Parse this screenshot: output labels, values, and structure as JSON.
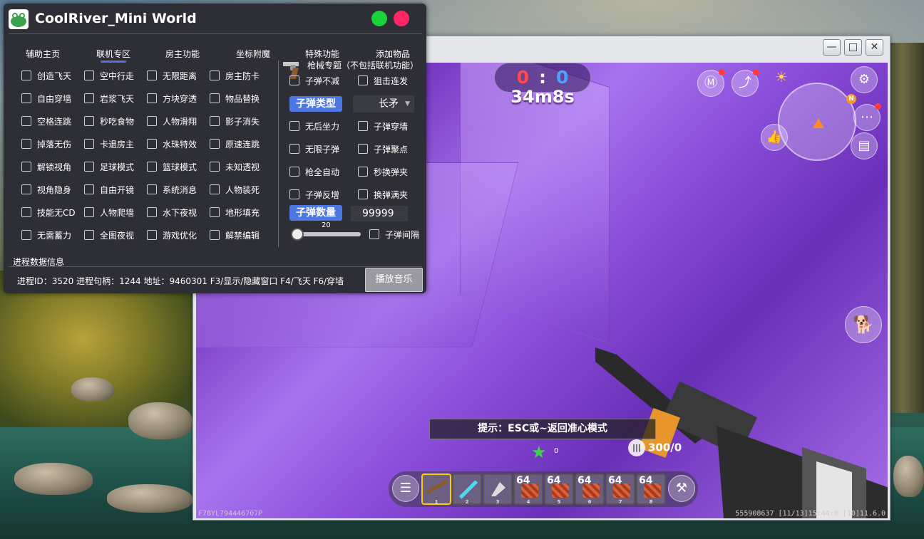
{
  "panel": {
    "title": "CoolRiver_Mini World",
    "tabs": [
      "辅助主页",
      "联机专区",
      "房主功能",
      "坐标附魔",
      "特殊功能",
      "添加物品"
    ],
    "active_tab": "联机专区",
    "columns": [
      [
        "创造飞天",
        "自由穿墙",
        "空格连跳",
        "掉落无伤",
        "解锁视角",
        "视角隐身",
        "技能无CD",
        "无需蓄力"
      ],
      [
        "空中行走",
        "岩浆飞天",
        "秒吃食物",
        "卡退房主",
        "足球模式",
        "自由开镜",
        "人物爬墙",
        "全图夜视"
      ],
      [
        "无限距离",
        "方块穿透",
        "人物滑翔",
        "水珠特效",
        "篮球模式",
        "系统消息",
        "水下夜视",
        "游戏优化"
      ],
      [
        "房主防卡",
        "物品替换",
        "影子消失",
        "原速连跳",
        "未知透视",
        "人物装死",
        "地形填充",
        "解禁编辑"
      ]
    ],
    "gun_section": {
      "title": "枪械专题（不包括联机功能）",
      "options_top": [
        "子弹不减",
        "狙击连发"
      ],
      "bullet_type_label": "子弹类型",
      "bullet_type_value": "长矛",
      "options_mid": [
        [
          "无后坐力",
          "子弹穿墙"
        ],
        [
          "无限子弹",
          "子弹聚点"
        ],
        [
          "枪全自动",
          "秒换弹夹"
        ],
        [
          "子弹反增",
          "换弹满夹"
        ]
      ],
      "bullet_count_label": "子弹数量",
      "bullet_count_value": "99999",
      "slider_value": "20",
      "slider_level": 0.0,
      "bullet_interval": "子弹间隔"
    },
    "process_section_label": "进程数据信息",
    "status": "进程ID：3520  进程句柄：1244 地址：9460301  F3/显示/隐藏窗口 F4/飞天 F6/穿墙",
    "play_button": "播放音乐"
  },
  "game_window": {
    "controls": {
      "minimize": "—",
      "maximize": "□",
      "close": "✕"
    },
    "score": {
      "red": "0",
      "separator": ":",
      "blue": "0"
    },
    "timer": "34m8s",
    "hint": "提示：ESC或~返回准心模式",
    "ammo": "300/0",
    "star_count": "0",
    "compass_letter": "N",
    "hotbar": {
      "counts": [
        "",
        "",
        "",
        "64",
        "64",
        "64",
        "64",
        "64"
      ],
      "numbers": [
        "1",
        "2",
        "3",
        "4",
        "5",
        "6",
        "7",
        "8"
      ],
      "selected": 1
    },
    "debug_left": "F78YL794446707P",
    "debug_right": "555908637  [11/13]15:44:0  [10]11.6.0"
  },
  "colors": {
    "panel_bg": "#2e2e36",
    "accent_blue": "#4d77e3",
    "close_green": "#18d33a",
    "close_pink": "#ff2766",
    "hotbar_selected": "#ffd000"
  },
  "icons": [
    "frog-app-icon",
    "revolver-icon",
    "shop-icon",
    "share-icon",
    "sun-icon",
    "settings-icon",
    "more-icon",
    "thumbs-up-icon",
    "backpack-icon",
    "pet-icon",
    "chat-icon",
    "craft-icon",
    "bullet-icon",
    "star-icon"
  ]
}
